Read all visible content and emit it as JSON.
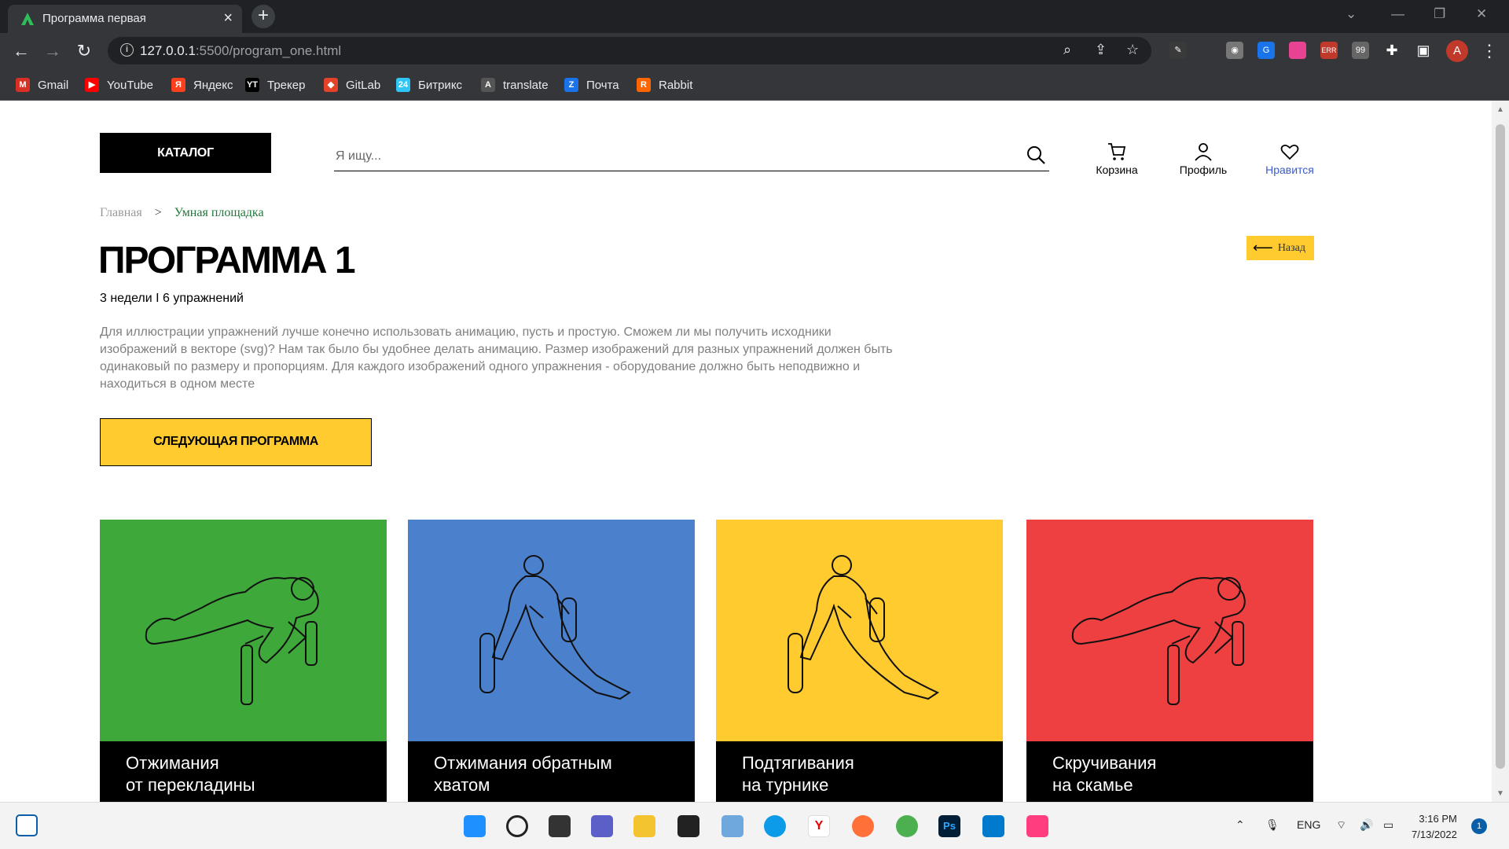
{
  "browser": {
    "tab_title": "Программа первая",
    "url_host": "127.0.0.1",
    "url_path": ":5500/program_one.html",
    "bookmarks": [
      {
        "label": "Gmail",
        "icon": "gmail-icon",
        "color": "#d93025",
        "glyph": "M"
      },
      {
        "label": "YouTube",
        "icon": "youtube-icon",
        "color": "#ff0000",
        "glyph": "▶"
      },
      {
        "label": "Яндекс",
        "icon": "yandex-icon",
        "color": "#fc3f1d",
        "glyph": "Я"
      },
      {
        "label": "Трекер",
        "icon": "tracker-icon",
        "color": "#000000",
        "glyph": "YT"
      },
      {
        "label": "GitLab",
        "icon": "gitlab-icon",
        "color": "#e24329",
        "glyph": "◆"
      },
      {
        "label": "Битрикс",
        "icon": "bitrix-icon",
        "color": "#2fc6f6",
        "glyph": "24"
      },
      {
        "label": "translate",
        "icon": "translate-icon",
        "color": "#555555",
        "glyph": "A"
      },
      {
        "label": "Почта",
        "icon": "mail-icon",
        "color": "#1a73e8",
        "glyph": "Z"
      },
      {
        "label": "Rabbit",
        "icon": "rabbit-icon",
        "color": "#ff6600",
        "glyph": "R"
      }
    ],
    "ext_badge": "ERR",
    "avatar_letter": "A"
  },
  "header": {
    "catalog_label": "КАТАЛОГ",
    "search_placeholder": "Я ищу...",
    "cart_label": "Корзина",
    "profile_label": "Профиль",
    "favorites_label": "Нравится"
  },
  "breadcrumb": {
    "home": "Главная",
    "separator": ">",
    "current": "Умная площадка"
  },
  "back_label": "Назад",
  "program": {
    "title": "ПРОГРАММА 1",
    "subtitle": "3 недели I 6 упражнений",
    "description": "Для иллюстрации упражнений лучше конечно использовать анимацию, пусть и простую. Сможем ли мы получить исходники изображений в векторе (svg)? Нам так было бы удобнее делать анимацию. Размер изображений для разных упражнений должен быть одинаковый по размеру и пропорциям. Для каждого изображений одного упражнения - оборудование должно быть неподвижно и находиться в одном месте",
    "next_label": "СЛЕДУЮЩАЯ ПРОГРАММА"
  },
  "exercises": [
    {
      "line1": "Отжимания",
      "line2": "от перекладины",
      "color": "#3ea83a",
      "pose": "pushup"
    },
    {
      "line1": "Отжимания обратным",
      "line2": "хватом",
      "color": "#4b80cc",
      "pose": "dips"
    },
    {
      "line1": "Подтягивания",
      "line2": "на турнике",
      "color": "#ffcb2f",
      "pose": "dips"
    },
    {
      "line1": "Скручивания",
      "line2": "на скамье",
      "color": "#ee4040",
      "pose": "pushup"
    }
  ],
  "taskbar": {
    "lang": "ENG",
    "time": "3:16 PM",
    "date": "7/13/2022",
    "notifications": "1"
  },
  "colors": {
    "accent_yellow": "#ffcb2f",
    "link_blue": "#3a5bcc",
    "breadcrumb_green": "#1e7a3a"
  }
}
